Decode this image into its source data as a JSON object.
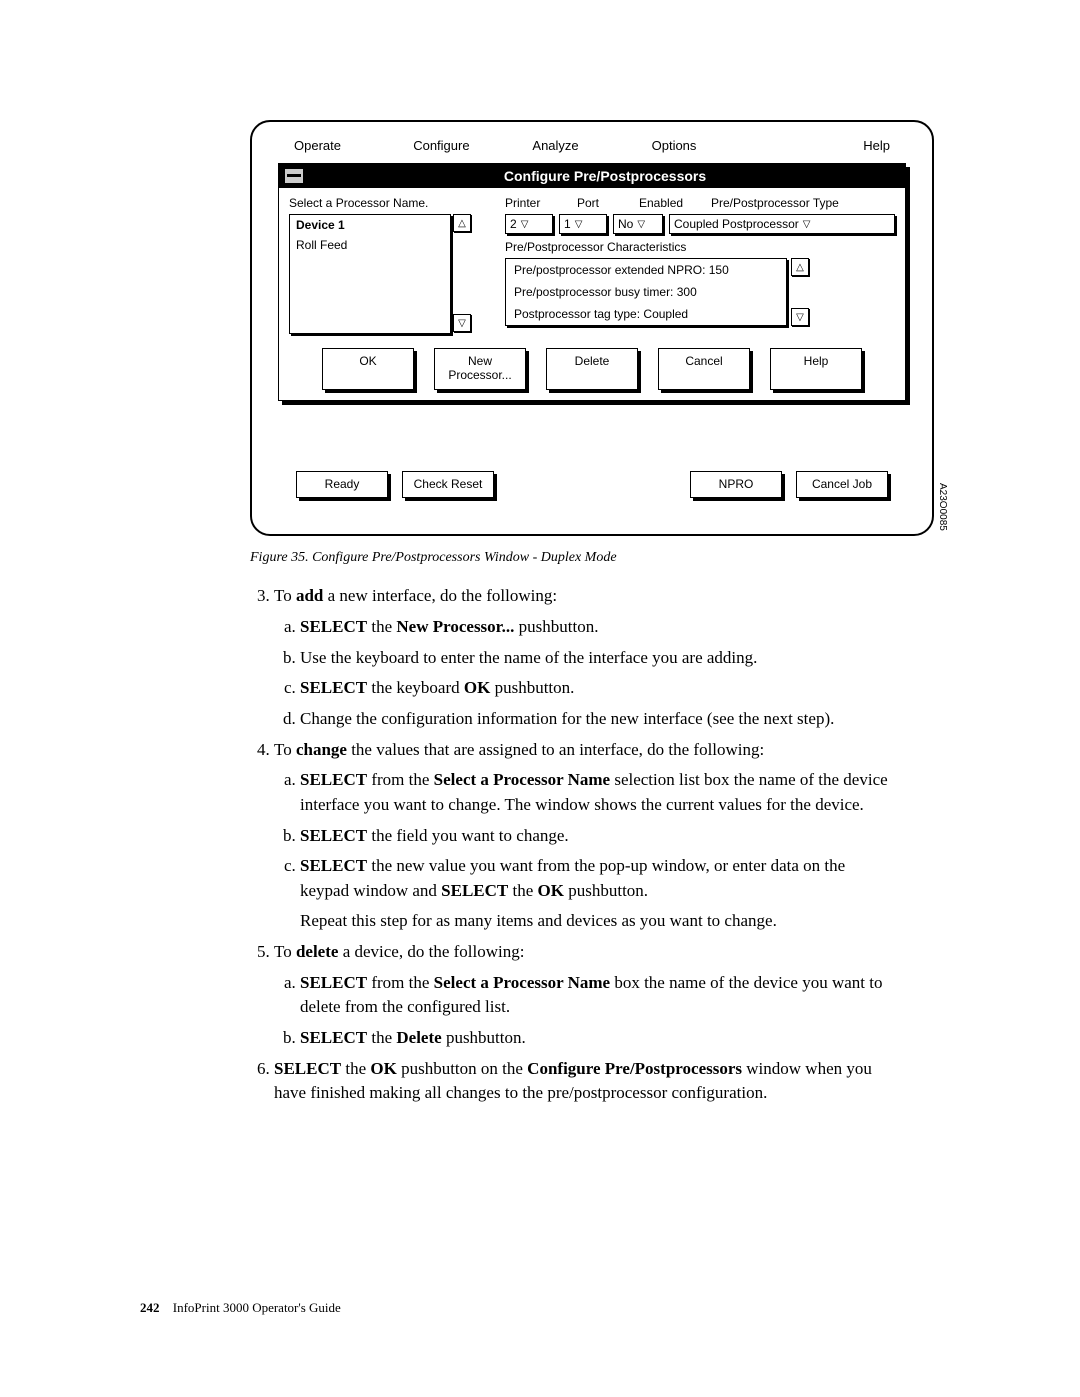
{
  "menubar": {
    "operate": "Operate",
    "configure": "Configure",
    "analyze": "Analyze",
    "options": "Options",
    "help": "Help"
  },
  "dialog": {
    "title": "Configure Pre/Postprocessors",
    "select_label": "Select a Processor Name.",
    "list": {
      "item0": "Device 1",
      "item1": "Roll Feed"
    },
    "hdr": {
      "printer": "Printer",
      "port": "Port",
      "enabled": "Enabled",
      "type": "Pre/Postprocessor Type"
    },
    "vals": {
      "printer": "2",
      "port": "1",
      "enabled": "No",
      "type": "Coupled Postprocessor"
    },
    "char_label": "Pre/Postprocessor Characteristics",
    "char": {
      "l1": "Pre/postprocessor extended NPRO: 150",
      "l2": "Pre/postprocessor busy timer: 300",
      "l3": "Postprocessor tag type: Coupled"
    },
    "tri_up": "△",
    "tri_down": "▽",
    "buttons": {
      "ok": "OK",
      "new": "New\nProcessor...",
      "delete": "Delete",
      "cancel": "Cancel",
      "help": "Help"
    }
  },
  "bottom": {
    "ready": "Ready",
    "check_reset": "Check Reset",
    "npro": "NPRO",
    "cancel_job": "Cancel Job"
  },
  "figure_id": "A23O0085",
  "caption": "Figure 35. Configure Pre/Postprocessors Window - Duplex Mode",
  "body": {
    "s3": {
      "lead_a": "To ",
      "lead_b": "add",
      "lead_c": " a new interface, do the following:",
      "a_a": "SELECT",
      "a_b": " the ",
      "a_c": "New Processor...",
      "a_d": " pushbutton.",
      "b": "Use the keyboard to enter the name of the interface you are adding.",
      "c_a": "SELECT",
      "c_b": " the keyboard ",
      "c_c": "OK",
      "c_d": " pushbutton.",
      "d": "Change the configuration information for the new interface (see the next step)."
    },
    "s4": {
      "lead_a": "To ",
      "lead_b": "change",
      "lead_c": " the values that are assigned to an interface, do the following:",
      "a_a": "SELECT",
      "a_b": " from the ",
      "a_c": "Select a Processor Name",
      "a_d": " selection list box the name of the device interface you want to change. The window shows the current values for the device.",
      "b_a": "SELECT",
      "b_b": " the field you want to change.",
      "c_a": "SELECT",
      "c_b": " the new value you want from the pop-up window, or enter data on the keypad window and ",
      "c_c": "SELECT",
      "c_d": " the ",
      "c_e": "OK",
      "c_f": " pushbutton.",
      "c_extra": "Repeat this step for as many items and devices as you want to change."
    },
    "s5": {
      "lead_a": "To ",
      "lead_b": "delete",
      "lead_c": " a device, do the following:",
      "a_a": "SELECT",
      "a_b": " from the ",
      "a_c": "Select a Processor Name",
      "a_d": " box the name of the device you want to delete from the configured list.",
      "b_a": "SELECT",
      "b_b": " the ",
      "b_c": "Delete",
      "b_d": " pushbutton."
    },
    "s6": {
      "a": "SELECT",
      "b": " the ",
      "c": "OK",
      "d": " pushbutton on the ",
      "e": "Configure Pre/Postprocessors",
      "f": " window when you have finished making all changes to the pre/postprocessor configuration."
    }
  },
  "footer": {
    "page": "242",
    "book": "InfoPrint 3000 Operator's Guide"
  }
}
